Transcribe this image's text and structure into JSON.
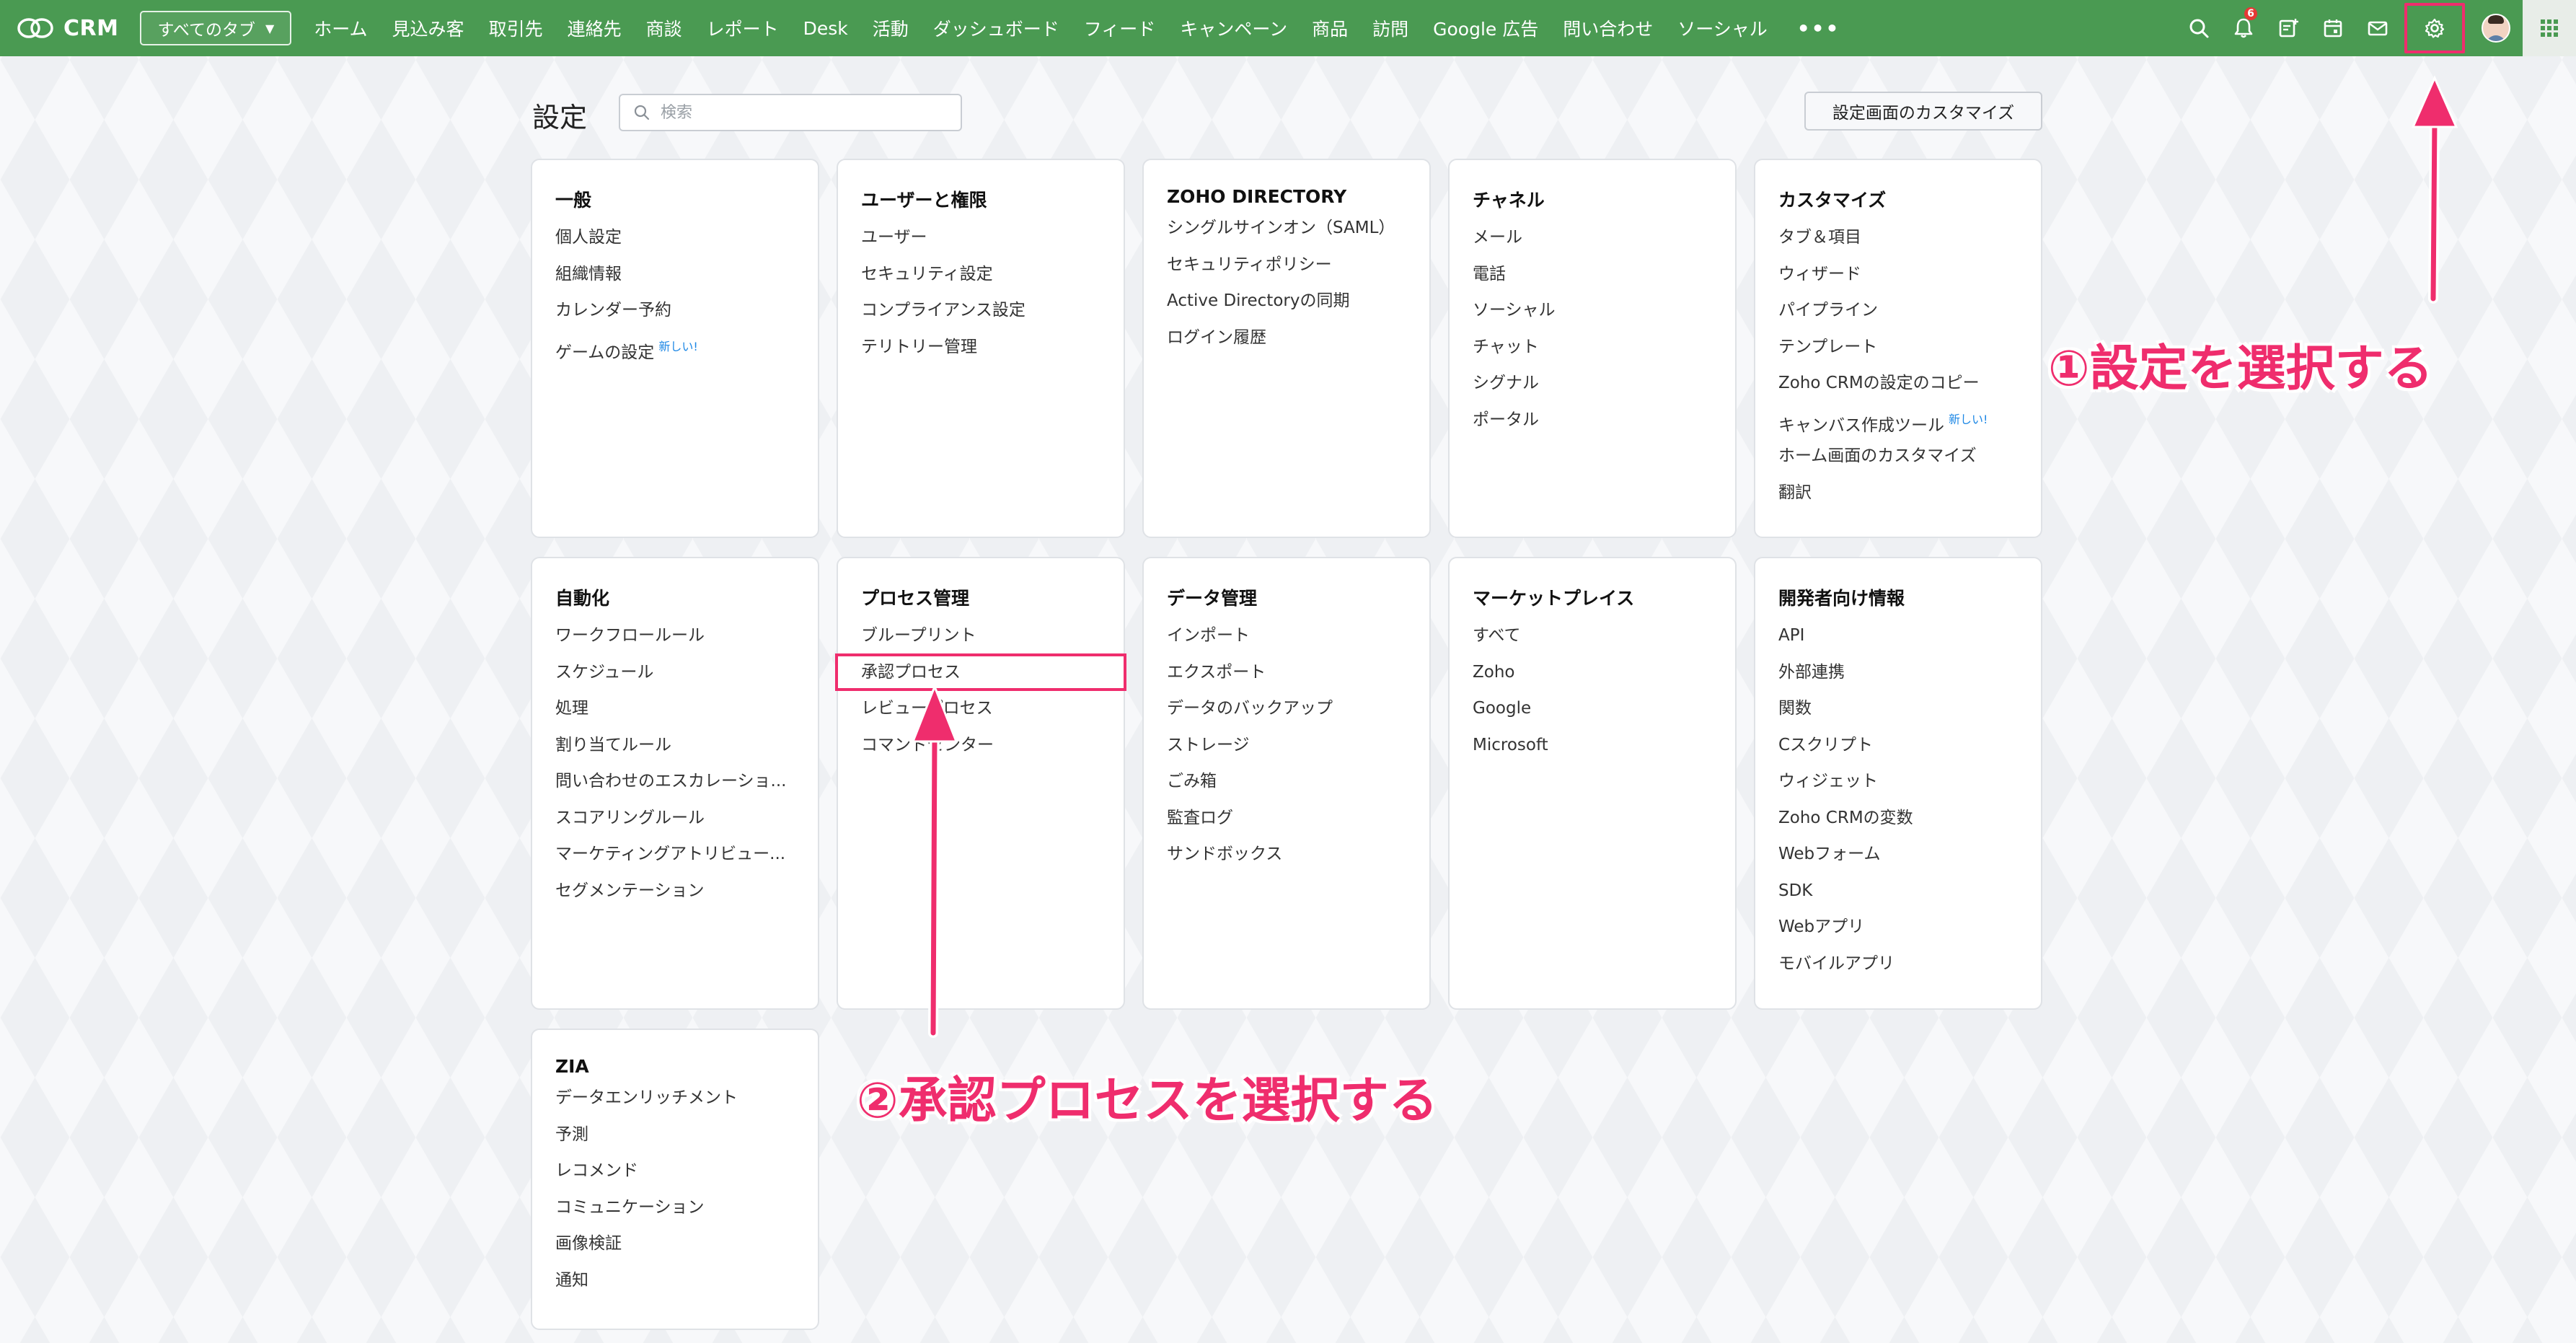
{
  "topbar": {
    "brand": "CRM",
    "all_tabs_label": "すべてのタブ",
    "nav_items": [
      "ホーム",
      "見込み客",
      "取引先",
      "連絡先",
      "商談",
      "レポート",
      "Desk",
      "活動",
      "ダッシュボード",
      "フィード",
      "キャンペーン",
      "商品",
      "訪問",
      "Google 広告",
      "問い合わせ",
      "ソーシャル"
    ],
    "more_label": "•••",
    "notification_count": "6",
    "icons": [
      "search-icon",
      "bell-icon",
      "note-add-icon",
      "calendar-icon",
      "mail-icon",
      "gear-icon",
      "avatar",
      "apps-grid-icon"
    ],
    "accent_color": "#4a9a52"
  },
  "header": {
    "title": "設定",
    "search_placeholder": "検索",
    "customize_button": "設定画面のカスタマイズ"
  },
  "sections": [
    {
      "title": "一般",
      "items": [
        "個人設定",
        "組織情報",
        "カレンダー予約",
        "ゲームの設定"
      ],
      "new_label": "新しい!"
    },
    {
      "title": "ユーザーと権限",
      "items": [
        "ユーザー",
        "セキュリティ設定",
        "コンプライアンス設定",
        "テリトリー管理"
      ]
    },
    {
      "title": "ZOHO DIRECTORY",
      "items": [
        "シングルサインオン（SAML）",
        "セキュリティポリシー",
        "Active Directoryの同期",
        "ログイン履歴"
      ]
    },
    {
      "title": "チャネル",
      "items": [
        "メール",
        "電話",
        "ソーシャル",
        "チャット",
        "シグナル",
        "ポータル"
      ]
    },
    {
      "title": "カスタマイズ",
      "items": [
        "タブ＆項目",
        "ウィザード",
        "パイプライン",
        "テンプレート",
        "Zoho CRMの設定のコピー",
        "キャンバス作成ツール",
        "ホーム画面のカスタマイズ",
        "翻訳"
      ],
      "new_label": "新しい!"
    },
    {
      "title": "自動化",
      "items": [
        "ワークフロールール",
        "スケジュール",
        "処理",
        "割り当てルール",
        "問い合わせのエスカレーショ...",
        "スコアリングルール",
        "マーケティングアトリビュー...",
        "セグメンテーション"
      ]
    },
    {
      "title": "プロセス管理",
      "items": [
        "ブループリント",
        "承認プロセス",
        "レビュープロセス",
        "コマンドセンター"
      ]
    },
    {
      "title": "データ管理",
      "items": [
        "インポート",
        "エクスポート",
        "データのバックアップ",
        "ストレージ",
        "ごみ箱",
        "監査ログ",
        "サンドボックス"
      ]
    },
    {
      "title": "マーケットプレイス",
      "items": [
        "すべて",
        "Zoho",
        "Google",
        "Microsoft"
      ]
    },
    {
      "title": "開発者向け情報",
      "items": [
        "API",
        "外部連携",
        "関数",
        "Cスクリプト",
        "ウィジェット",
        "Zoho CRMの変数",
        "Webフォーム",
        "SDK",
        "Webアプリ",
        "モバイルアプリ"
      ]
    },
    {
      "title": "ZIA",
      "items": [
        "データエンリッチメント",
        "予測",
        "レコメンド",
        "コミュニケーション",
        "画像検証",
        "通知"
      ]
    }
  ],
  "annotations": {
    "step1": "①設定を選択する",
    "step2": "②承認プロセスを選択する",
    "color": "#ef2d6d"
  }
}
